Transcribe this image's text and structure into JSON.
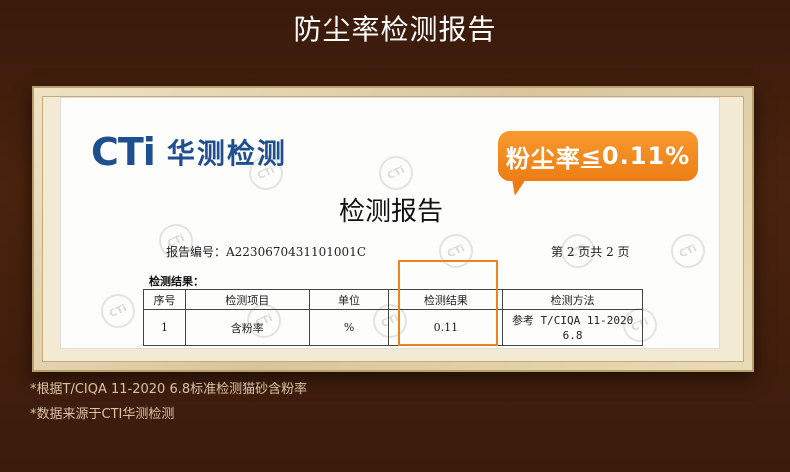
{
  "heading": "防尘率检测报告",
  "logo": {
    "brand": "CTi",
    "cn_name": "华测检测"
  },
  "document": {
    "title": "检测报告",
    "report_no": "报告编号：A2230670431101001C",
    "page_no": "第 2 页共 2 页",
    "results_label": "检测结果：",
    "table": {
      "headers": [
        "序号",
        "检测项目",
        "单位",
        "检测结果",
        "检测方法"
      ],
      "rows": [
        [
          "1",
          "含粉率",
          "%",
          "0.11",
          "参考 T/CIQA 11-2020 6.8"
        ]
      ]
    }
  },
  "badge": {
    "prefix": "粉尘率",
    "symbol": "≤",
    "value": "0.11%"
  },
  "footnotes": [
    "*根据T/CIQA 11-2020 6.8标准检测猫砂含粉率",
    "*数据来源于CTI华测检测"
  ],
  "colors": {
    "accent": "#f0821e",
    "logo_blue": "#1f4f8f",
    "background": "#3f1d0b"
  }
}
